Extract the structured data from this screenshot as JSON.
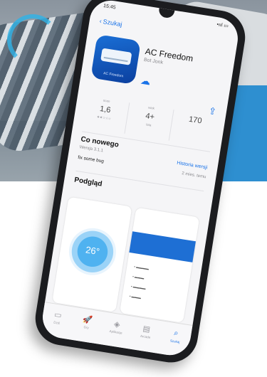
{
  "status": {
    "time": "15:45",
    "battery": "•ııl ▭"
  },
  "nav": {
    "back_label": "Szukaj"
  },
  "app": {
    "name": "AC Freedom",
    "developer": "Bot Jonk",
    "icon_label": "AC Freedom"
  },
  "stats": [
    {
      "caption": "ocen",
      "value": "1,6",
      "sub": "★★☆☆☆"
    },
    {
      "caption": "wiek",
      "value": "4+",
      "sub": "lata"
    },
    {
      "caption": "",
      "value": "170",
      "sub": ""
    }
  ],
  "whats_new": {
    "title": "Co nowego",
    "version": "Wersja 3.1.1",
    "history_link": "Historia wersji",
    "date": "2 mies. temu",
    "notes": "fix some bug"
  },
  "preview": {
    "title": "Podgląd",
    "temperature": "26°"
  },
  "tabs": [
    {
      "label": "Dziś",
      "icon": "▭"
    },
    {
      "label": "Gry",
      "icon": "🚀"
    },
    {
      "label": "Aplikacje",
      "icon": "◈"
    },
    {
      "label": "Arcade",
      "icon": "▤"
    },
    {
      "label": "Szukaj",
      "icon": "⌕"
    }
  ],
  "colors": {
    "accent": "#1a73e8",
    "icon_blue": "#1a6fd6",
    "phone_body": "#1b1c1f"
  }
}
